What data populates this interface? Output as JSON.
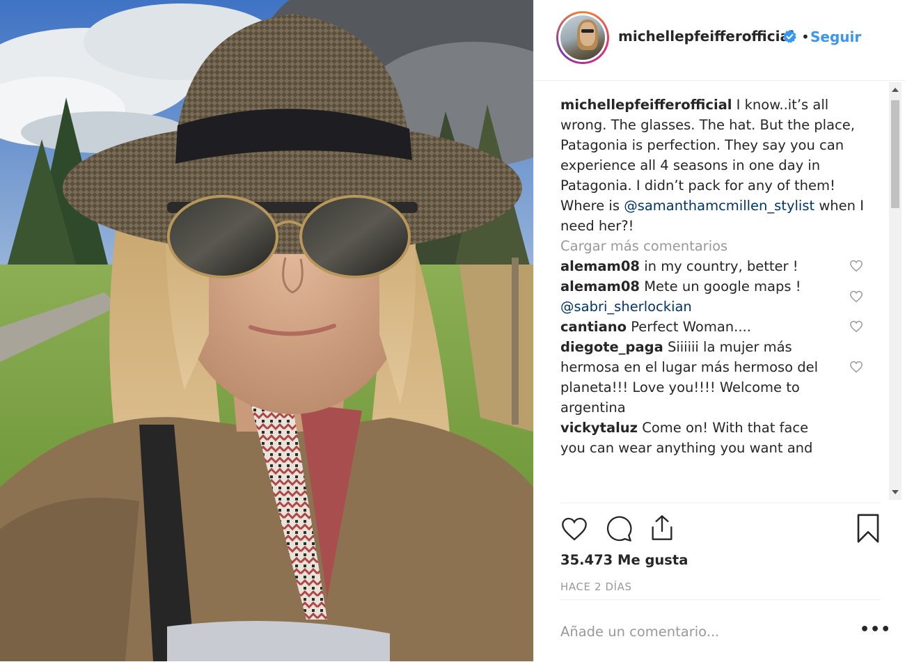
{
  "post": {
    "username": "michellepfeifferofficial",
    "verified": true,
    "separator": "•",
    "follow_label": "Seguir",
    "caption_username": "michellepfeifferofficial",
    "caption_text_1": " I know..it’s all wrong. The glasses. The hat. But the place, Patagonia is perfection. They say you can experience all 4 seasons in one day in Patagonia. I didn’t pack for any of them! Where is ",
    "caption_mention": "@samanthamcmillen_stylist",
    "caption_text_2": " when I need her?!",
    "load_more": "Cargar más comentarios",
    "likes": "35.473 Me gusta",
    "time_ago": "HACE 2 DÍAS",
    "add_comment_placeholder": "Añade un comentario...",
    "more_options": "•••"
  },
  "comments": [
    {
      "user": "alemam08",
      "text": " in my country, better !"
    },
    {
      "user": "alemam08",
      "text": " Mete un google maps ! ",
      "mention": "@sabri_sherlockian"
    },
    {
      "user": "cantiano",
      "text": " Perfect Woman...."
    },
    {
      "user": "diegote_paga",
      "text": " Siiiiii la mujer más hermosa en el lugar más hermoso del planeta!!! Love you!!!! Welcome to argentina"
    },
    {
      "user": "vickytaluz",
      "text": " Come on! With that face you can wear anything you want and"
    }
  ],
  "colors": {
    "link": "#3897f0",
    "mention": "#003569",
    "muted": "#999999",
    "text": "#262626",
    "verified": "#3897f0"
  },
  "icons": [
    "verified-badge-icon",
    "heart-icon",
    "comment-icon",
    "share-icon",
    "bookmark-icon",
    "comment-heart-icon"
  ]
}
